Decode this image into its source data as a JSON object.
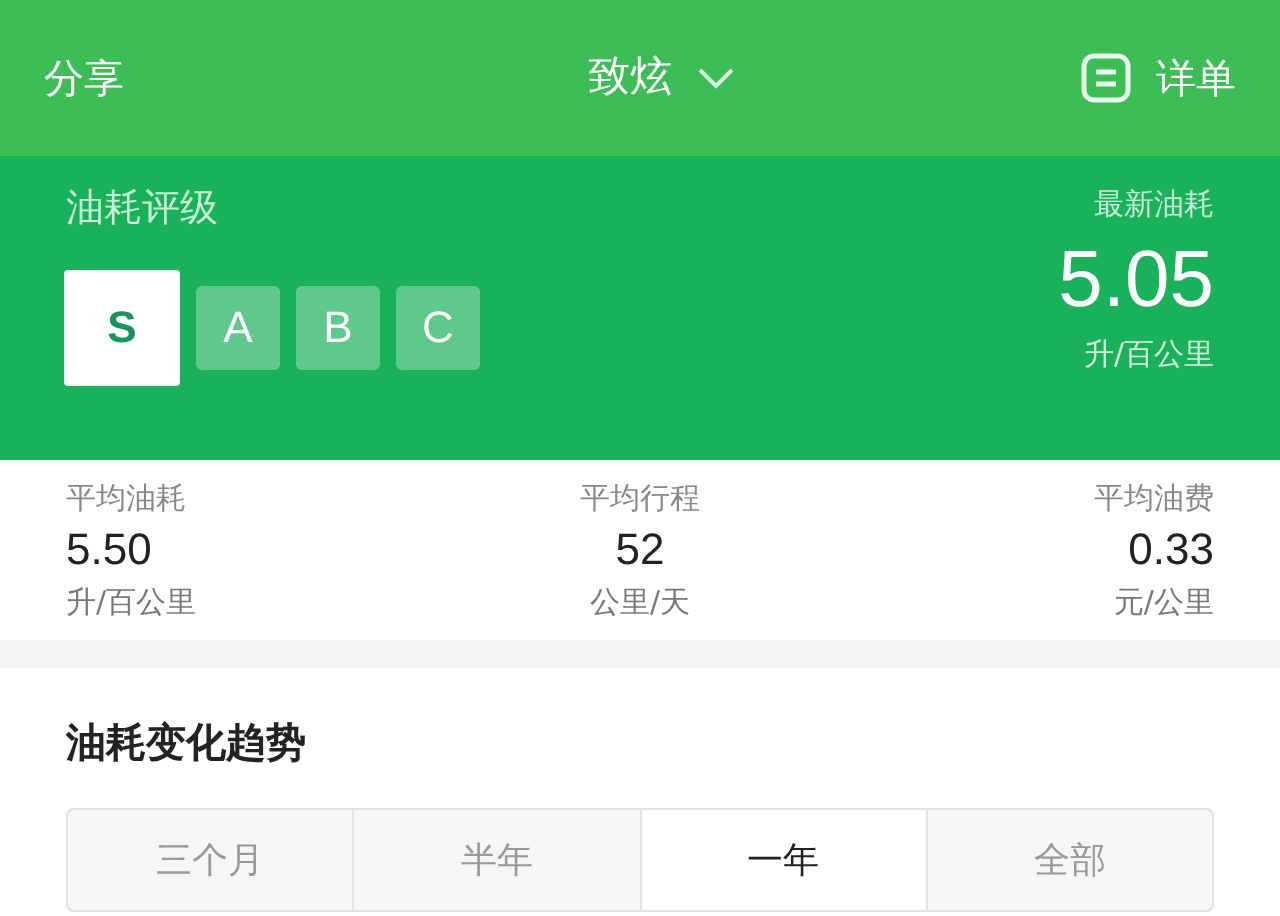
{
  "header": {
    "left": "分享",
    "title": "致炫",
    "right": "详单"
  },
  "rating": {
    "label": "油耗评级",
    "grades": [
      {
        "label": "S",
        "selected": true
      },
      {
        "label": "A",
        "selected": false
      },
      {
        "label": "B",
        "selected": false
      },
      {
        "label": "C",
        "selected": false
      }
    ],
    "latest_label": "最新油耗",
    "latest_value": "5.05",
    "latest_unit": "升/百公里"
  },
  "stats": [
    {
      "label": "平均油耗",
      "value": "5.50",
      "unit": "升/百公里"
    },
    {
      "label": "平均行程",
      "value": "52",
      "unit": "公里/天"
    },
    {
      "label": "平均油费",
      "value": "0.33",
      "unit": "元/公里"
    }
  ],
  "trend": {
    "title": "油耗变化趋势",
    "tabs": [
      {
        "label": "三个月",
        "selected": false
      },
      {
        "label": "半年",
        "selected": false
      },
      {
        "label": "一年",
        "selected": true
      },
      {
        "label": "全部",
        "selected": false
      }
    ]
  }
}
